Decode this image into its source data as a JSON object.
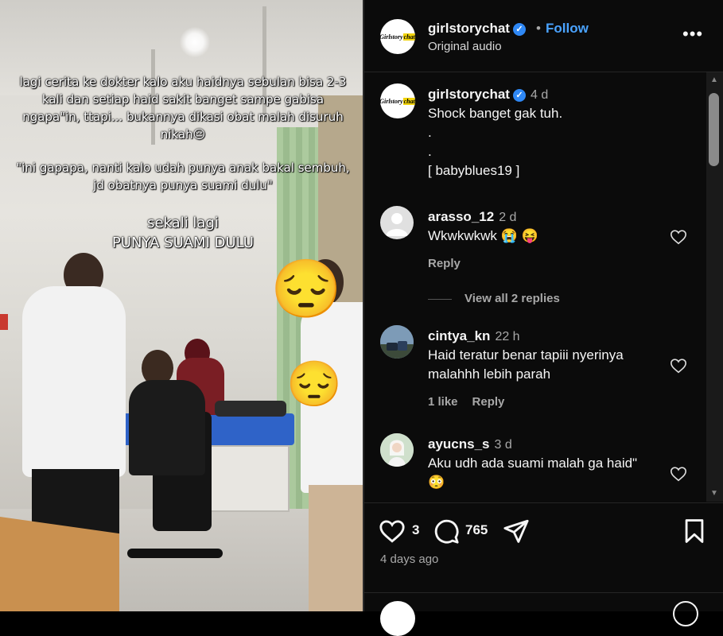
{
  "video": {
    "caption_1": "lagi cerita ke dokter kalo aku haidnya sebulan bisa 2-3 kali dan setiap haid sakit banget sampe gabisa ngapa\"in, ttapi... bukannya dikasi obat  malah disuruh nikah😔",
    "caption_2": "\"ini gapapa, nanti kalo udah punya anak bakal sembuh, jd obatnya punya suami dulu\"",
    "caption_3": "sekali lagi\nPUNYA SUAMI DULU",
    "sticker_emoji": "😔"
  },
  "header": {
    "username": "girlstorychat",
    "verified": "✓",
    "dot": "•",
    "follow_label": "Follow",
    "subtitle": "Original audio",
    "more": "•••",
    "avatar_text_a": "Girlstory",
    "avatar_text_b": "chat"
  },
  "post_caption": {
    "username": "girlstorychat",
    "time": "4 d",
    "text": "Shock banget gak tuh.\n.\n.\n[ babyblues19 ]"
  },
  "comments": [
    {
      "username": "arasso_12",
      "time": "2 d",
      "text": "Wkwkwkwk 😭 😝",
      "reply_label": "Reply",
      "view_replies": "View all 2 replies"
    },
    {
      "username": "cintya_kn",
      "time": "22 h",
      "text": "Haid teratur benar tapiii nyerinya malahhh lebih parah",
      "likes_label": "1 like",
      "reply_label": "Reply"
    },
    {
      "username": "ayucns_s",
      "time": "3 d",
      "text": "Aku udh ada suami malah ga haid\"\n😳"
    }
  ],
  "actions": {
    "like_count": "3",
    "comment_count": "765",
    "posted": "4 days ago"
  },
  "colors": {
    "accent": "#4aa3ff",
    "verified": "#2f88f5",
    "background": "#0b0b0b"
  }
}
